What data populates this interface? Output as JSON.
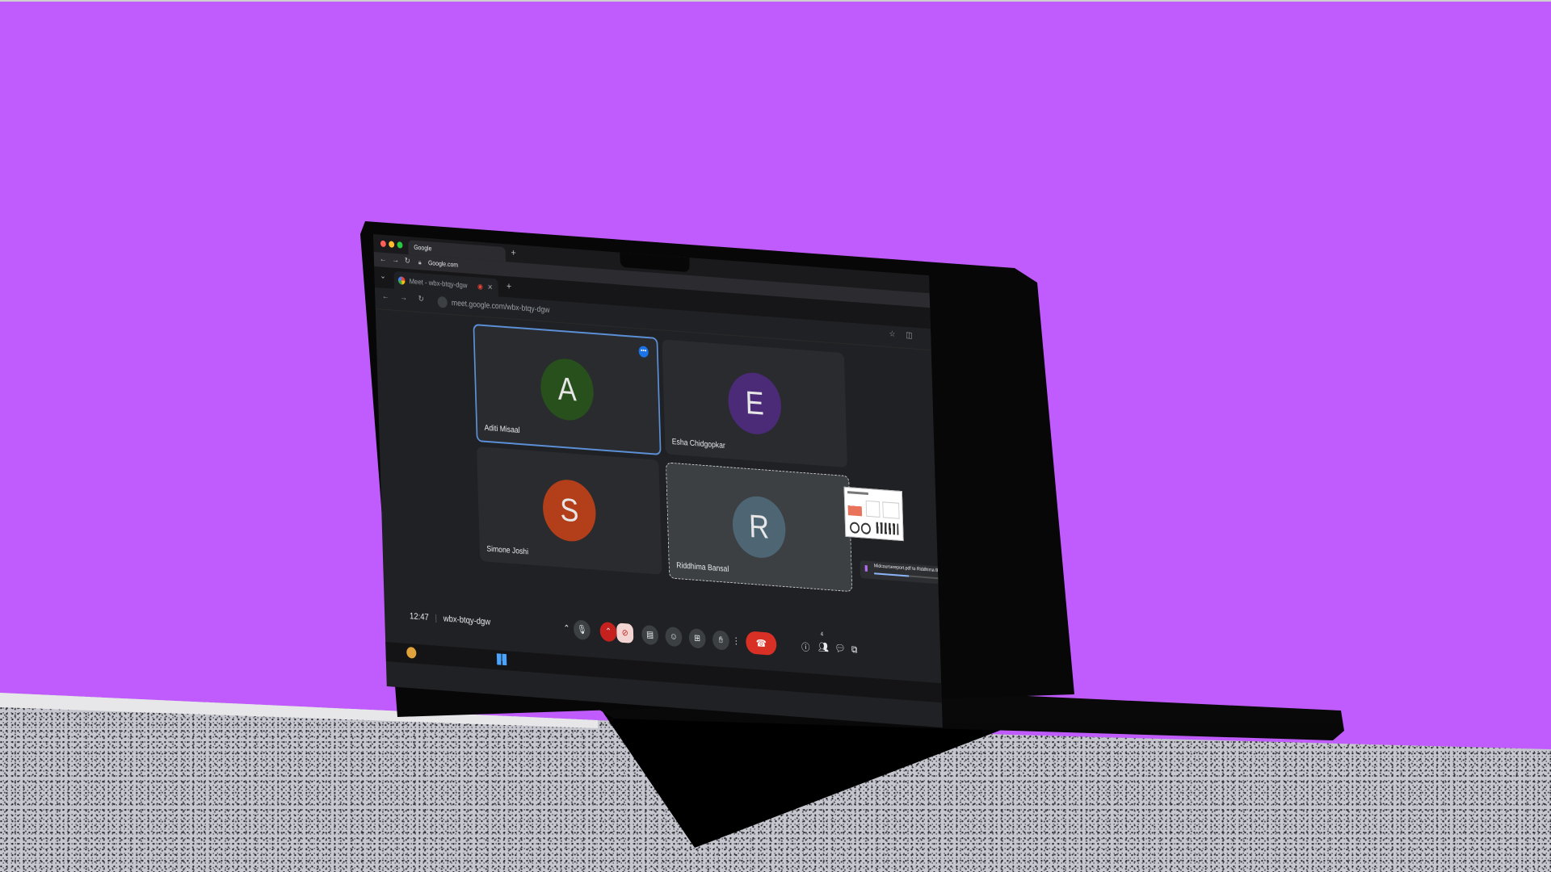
{
  "outer_browser": {
    "tab_title": "Google",
    "url": "Google.com",
    "new_tab": "+"
  },
  "inner_browser": {
    "tab_title": "Meet - wbx-btqy-dgw",
    "url": "meet.google.com/wbx-btqy-dgw",
    "new_tab": "+"
  },
  "participants": [
    {
      "initial": "A",
      "name": "Aditi Misaal",
      "avatar_color": "#27501c"
    },
    {
      "initial": "E",
      "name": "Esha Chidgopkar",
      "avatar_color": "#4b2b78"
    },
    {
      "initial": "S",
      "name": "Simone Joshi",
      "avatar_color": "#b23e1a"
    },
    {
      "initial": "R",
      "name": "Riddhima Bansal",
      "avatar_color": "#4e6574"
    }
  ],
  "meeting": {
    "time": "12:47",
    "code": "wbx-btqy-dgw",
    "people_count": "4"
  },
  "download_toast": {
    "text": "Midcoursereport.pdf to Riddhima Bansal"
  },
  "icons": {
    "mic": "mic-icon",
    "camera_off": "camera-off-icon",
    "captions": "captions-icon",
    "emoji": "emoji-icon",
    "present": "present-icon",
    "raise_hand": "raise-hand-icon",
    "more": "more-icon",
    "hang_up": "phone-hangup-icon",
    "info": "info-icon",
    "people": "people-icon",
    "chat": "chat-icon",
    "activities": "activities-icon"
  },
  "colors": {
    "background": "#c05cfd",
    "meet_bg": "#202124",
    "active_border": "#5b8fd6",
    "hangup": "#d93025"
  }
}
